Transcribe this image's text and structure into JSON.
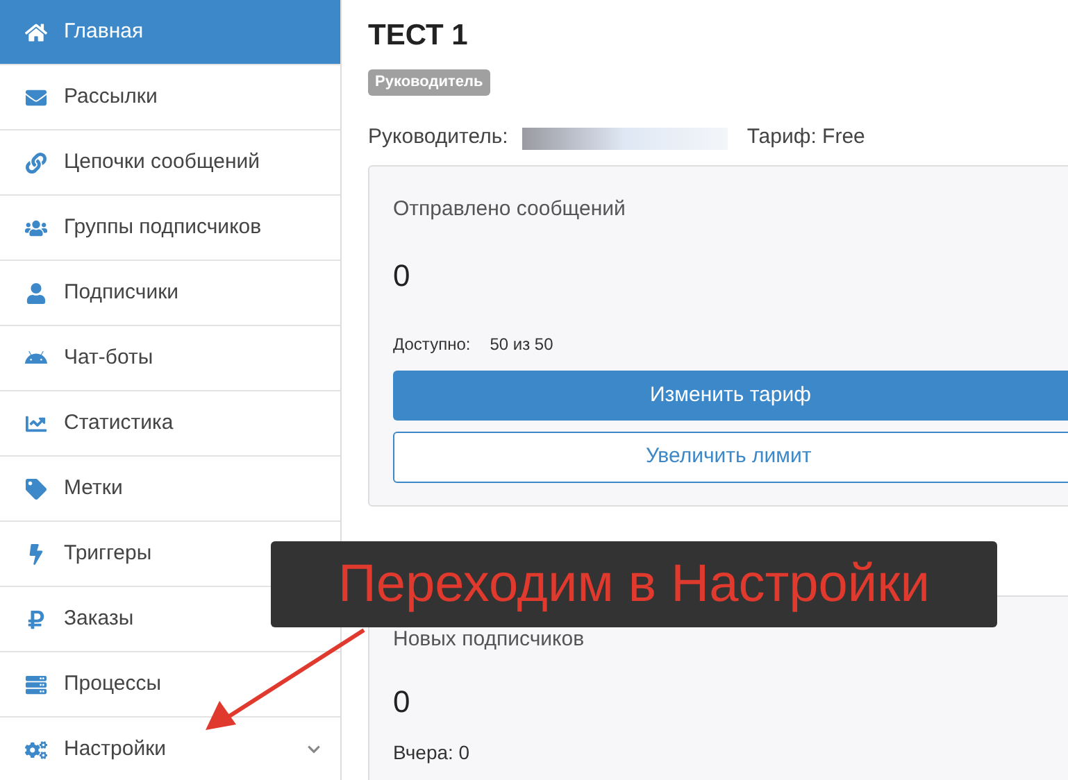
{
  "sidebar": {
    "items": [
      {
        "label": "Главная",
        "selected": true,
        "has_submenu": false
      },
      {
        "label": "Рассылки",
        "selected": false,
        "has_submenu": false
      },
      {
        "label": "Цепочки сообщений",
        "selected": false,
        "has_submenu": false
      },
      {
        "label": "Группы подписчиков",
        "selected": false,
        "has_submenu": false
      },
      {
        "label": "Подписчики",
        "selected": false,
        "has_submenu": false
      },
      {
        "label": "Чат-боты",
        "selected": false,
        "has_submenu": false
      },
      {
        "label": "Статистика",
        "selected": false,
        "has_submenu": false
      },
      {
        "label": "Метки",
        "selected": false,
        "has_submenu": false
      },
      {
        "label": "Триггеры",
        "selected": false,
        "has_submenu": false
      },
      {
        "label": "Заказы",
        "selected": false,
        "has_submenu": false
      },
      {
        "label": "Процессы",
        "selected": false,
        "has_submenu": false
      },
      {
        "label": "Настройки",
        "selected": false,
        "has_submenu": true
      }
    ]
  },
  "project": {
    "title": "ТЕСТ 1",
    "role_badge": "Руководитель",
    "owner_label": "Руководитель:",
    "tariff": "Тариф: Free"
  },
  "messages_card": {
    "title": "Отправлено сообщений",
    "value": "0",
    "available_label": "Доступно:",
    "available_value": "50 из 50",
    "primary_button": "Изменить тариф",
    "secondary_button": "Увеличить лимит"
  },
  "subscribers_card": {
    "title": "Новых подписчиков",
    "value": "0",
    "yesterday": "Вчера: 0"
  },
  "annotation": {
    "text": "Переходим в Настройки"
  }
}
